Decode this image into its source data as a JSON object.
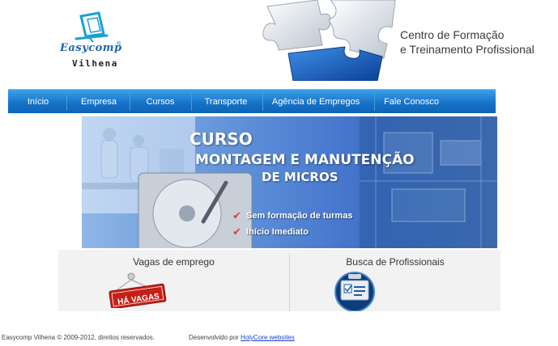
{
  "header": {
    "logo": {
      "brand": "Easycomp",
      "city": "Vilhena",
      "registered_mark": "®"
    },
    "tagline_line1": "Centro de Formação",
    "tagline_line2": "e Treinamento Profissional"
  },
  "nav": {
    "items": [
      {
        "label": "Início"
      },
      {
        "label": "Empresa"
      },
      {
        "label": "Cursos"
      },
      {
        "label": "Transporte"
      },
      {
        "label": "Agência de Empregos"
      },
      {
        "label": "Fale Conosco"
      }
    ]
  },
  "banner": {
    "line1": "CURSO",
    "line2": "MONTAGEM E MANUTENÇÃO",
    "line3": "DE MICROS",
    "features": [
      {
        "label": "Sem formação de turmas"
      },
      {
        "label": "Início Imediato"
      }
    ]
  },
  "boxes": {
    "jobs_title": "Vagas de emprego",
    "jobs_tag": "HÁ VAGAS",
    "professionals_title": "Busca de Profissionais"
  },
  "footer": {
    "copyright": "Easycomp Vilhena © 2009-2012, direitos reservados.",
    "developed_by": "Desenvolvido por",
    "developer_link": "HolyCore websites"
  },
  "colors": {
    "nav_blue": "#1571c7",
    "brand_blue": "#1c64b4",
    "accent_red": "#e53b2b"
  }
}
